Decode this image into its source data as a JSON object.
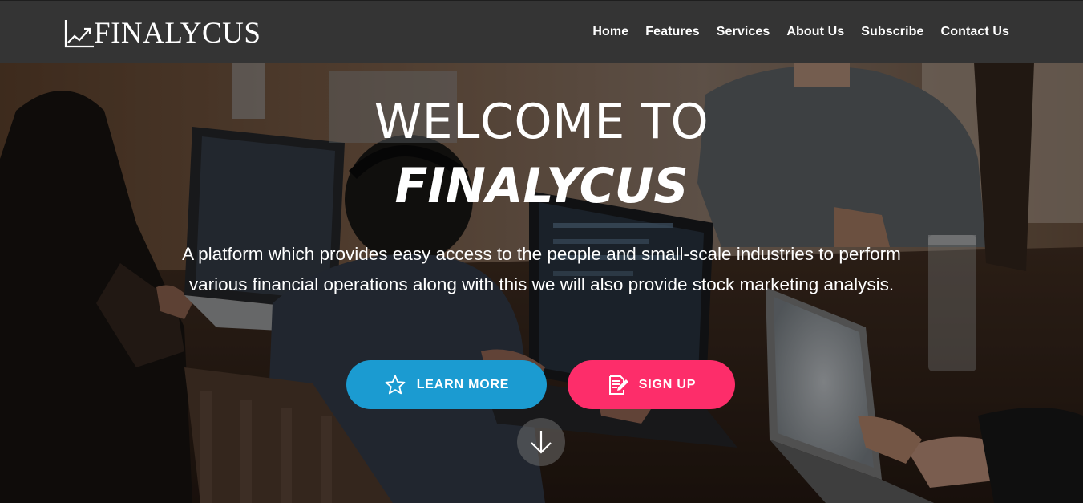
{
  "header": {
    "logo_text": "FINALYCUS",
    "nav": [
      {
        "label": "Home",
        "name": "nav-home"
      },
      {
        "label": "Features",
        "name": "nav-features"
      },
      {
        "label": "Services",
        "name": "nav-services"
      },
      {
        "label": "About Us",
        "name": "nav-about-us"
      },
      {
        "label": "Subscribe",
        "name": "nav-subscribe"
      },
      {
        "label": "Contact Us",
        "name": "nav-contact-us"
      }
    ]
  },
  "hero": {
    "title_line1": "WELCOME TO",
    "title_line2": "FINALYCUS",
    "subtitle": "A platform which provides easy access to the people and small-scale industries to perform various financial operations along with this we will also provide stock marketing analysis.",
    "learn_more": {
      "label": "LEARN MORE",
      "icon": "star-icon"
    },
    "sign_up": {
      "label": "SIGN UP",
      "icon": "edit-document-icon"
    },
    "scroll_icon": "arrow-down-icon"
  },
  "colors": {
    "header_bg": "#343434",
    "learn_more_bg": "#1b9bd1",
    "sign_up_bg": "#fd2d6a",
    "text": "#ffffff"
  }
}
